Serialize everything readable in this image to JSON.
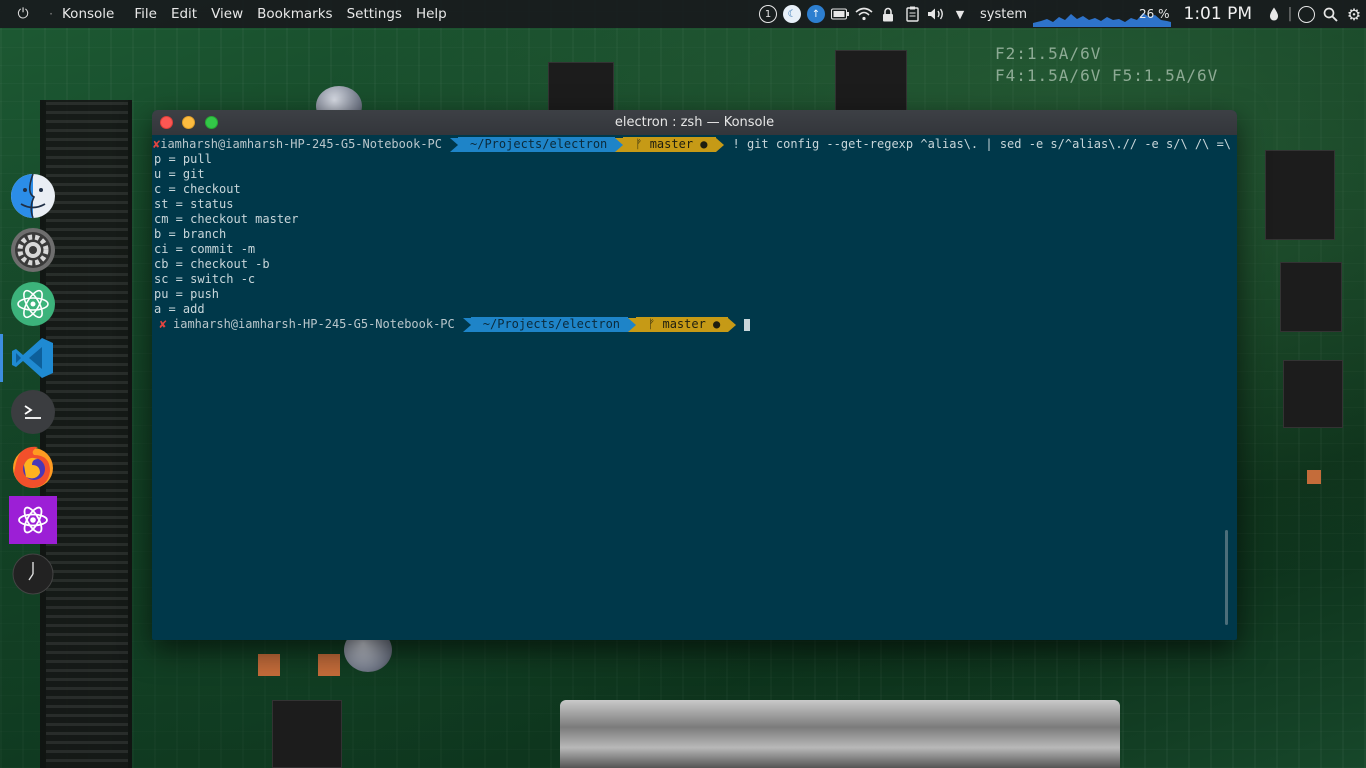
{
  "top_panel": {
    "app_name": "Konsole",
    "menu": [
      "File",
      "Edit",
      "View",
      "Bookmarks",
      "Settings",
      "Help"
    ],
    "tray_badge": "1",
    "system_label": "system",
    "cpu_percent": "26 %",
    "clock": "1:01 PM"
  },
  "dock": {
    "items": [
      "finder-icon",
      "system-settings-icon",
      "atom-icon",
      "vscode-icon",
      "terminal-icon",
      "firefox-icon",
      "react-devtools-icon",
      "clock-icon"
    ]
  },
  "window": {
    "title": "electron : zsh — Konsole",
    "prompt": {
      "user_host": "iamharsh@iamharsh-HP-245-G5-Notebook-PC",
      "path": "~/Projects/electron",
      "branch": "ᚠ master ●",
      "status_mark": "✘"
    },
    "command": "! git config --get-regexp ^alias\\. | sed -e s/^alias\\.// -e s/\\ /\\ =\\ /",
    "output": [
      "p = pull",
      "u = git",
      "c = checkout",
      "st = status",
      "cm = checkout master",
      "b = branch",
      "ci = commit -m",
      "cb = checkout -b",
      "sc = switch -c",
      "pu = push",
      "a = add"
    ]
  },
  "colors": {
    "terminal_bg": "#00384a",
    "path_segment": "#1e84c8",
    "git_segment": "#c69a16",
    "error_mark": "#e14540"
  }
}
